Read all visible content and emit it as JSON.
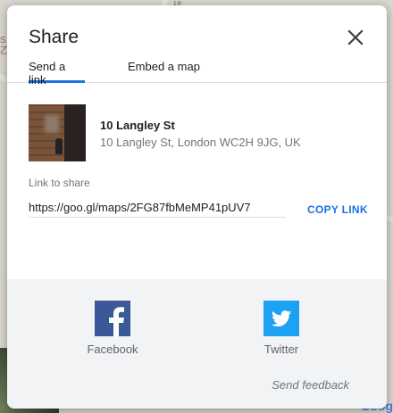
{
  "map": {
    "top_label": "¹º",
    "left_label": "S\n乙",
    "google_logo": "Goog"
  },
  "dialog": {
    "title": "Share",
    "tabs": [
      {
        "label": "Send a link",
        "active": true
      },
      {
        "label": "Embed a map",
        "active": false
      }
    ],
    "place": {
      "name": "10 Langley St",
      "address": "10 Langley St, London WC2H 9JG, UK"
    },
    "link": {
      "label": "Link to share",
      "value": "https://goo.gl/maps/2FG87fbMeMP41pUV7",
      "copy_label": "COPY LINK"
    },
    "social": [
      {
        "label": "Facebook",
        "icon": "facebook-icon",
        "color": "#3b5998"
      },
      {
        "label": "Twitter",
        "icon": "twitter-icon",
        "color": "#1da1f2"
      }
    ],
    "feedback_label": "Send feedback"
  },
  "colors": {
    "accent": "#1a73e8",
    "footer_bg": "#f1f3f4"
  }
}
